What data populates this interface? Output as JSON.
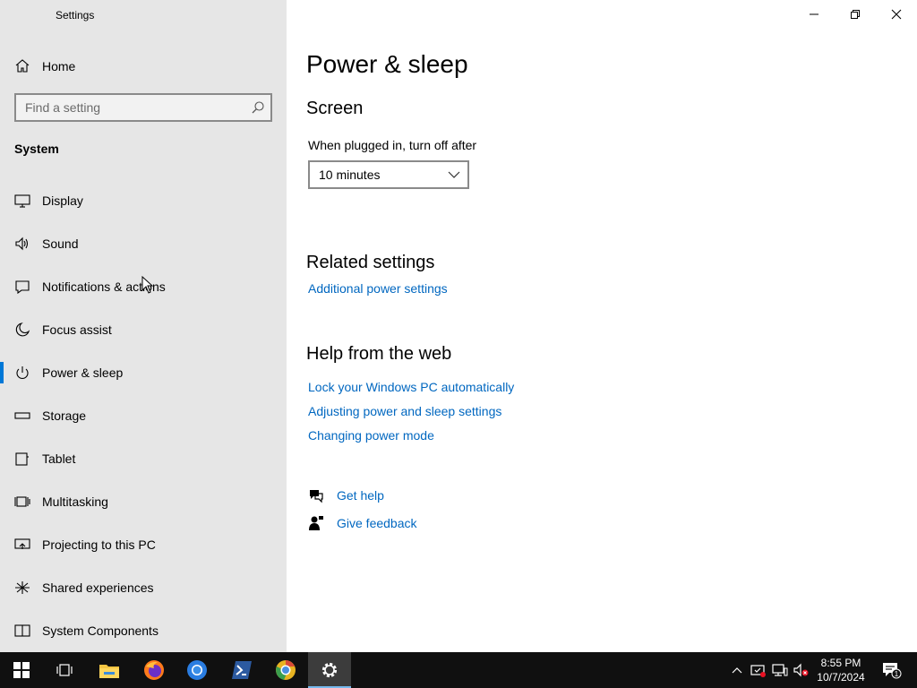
{
  "window": {
    "title": "Settings"
  },
  "sidebar": {
    "home_label": "Home",
    "search_placeholder": "Find a setting",
    "section_label": "System",
    "items": [
      {
        "label": "Display",
        "icon": "monitor-icon"
      },
      {
        "label": "Sound",
        "icon": "speaker-icon"
      },
      {
        "label": "Notifications & actions",
        "icon": "notification-icon"
      },
      {
        "label": "Focus assist",
        "icon": "moon-icon"
      },
      {
        "label": "Power & sleep",
        "icon": "power-icon",
        "selected": true
      },
      {
        "label": "Storage",
        "icon": "storage-icon"
      },
      {
        "label": "Tablet",
        "icon": "tablet-icon"
      },
      {
        "label": "Multitasking",
        "icon": "multitasking-icon"
      },
      {
        "label": "Projecting to this PC",
        "icon": "projecting-icon"
      },
      {
        "label": "Shared experiences",
        "icon": "shared-experiences-icon"
      },
      {
        "label": "System Components",
        "icon": "system-components-icon"
      }
    ]
  },
  "main": {
    "title": "Power & sleep",
    "screen_heading": "Screen",
    "plugged_label": "When plugged in, turn off after",
    "plugged_value": "10 minutes",
    "related_heading": "Related settings",
    "related_links": [
      "Additional power settings"
    ],
    "web_heading": "Help from the web",
    "web_links": [
      "Lock your Windows PC automatically",
      "Adjusting power and sleep settings",
      "Changing power mode"
    ],
    "get_help": "Get help",
    "give_feedback": "Give feedback"
  },
  "taskbar": {
    "time": "8:55 PM",
    "date": "10/7/2024",
    "notification_count": "1",
    "accent_color": "#0078d7"
  }
}
